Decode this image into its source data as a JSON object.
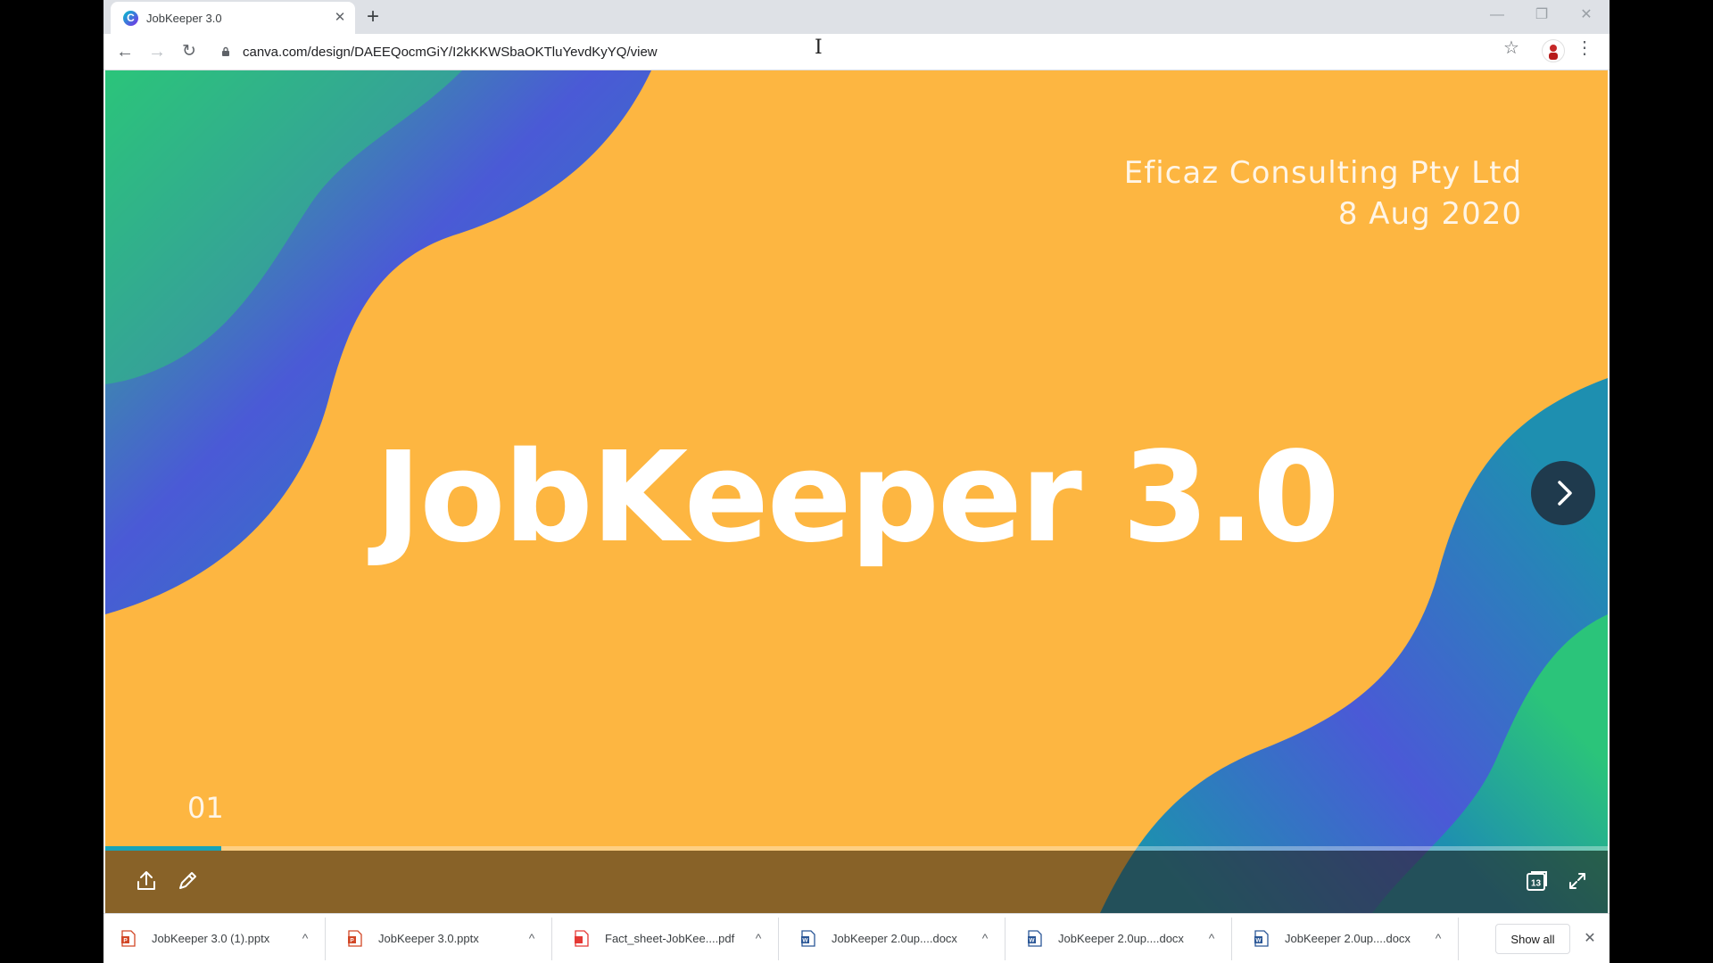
{
  "browser": {
    "tab_title": "JobKeeper 3.0",
    "favicon_letter": "C",
    "url": "canva.com/design/DAEEQocmGiY/I2kKKWSbaOKTluYevdKyYQ/view"
  },
  "slide": {
    "company": "Eficaz Consulting Pty Ltd",
    "date": "8 Aug 2020",
    "title": "JobKeeper 3.0",
    "number": "01",
    "progress": 0.077,
    "colors": {
      "background": "#fdb641",
      "wave_teal": "#1e8fb0",
      "wave_blue": "#4a5ad6",
      "wave_green": "#2bc47a"
    }
  },
  "viewer_controls": {
    "page_count_badge": "13"
  },
  "downloads": {
    "items": [
      {
        "name": "JobKeeper 3.0 (1).pptx",
        "type": "pptx"
      },
      {
        "name": "JobKeeper 3.0.pptx",
        "type": "pptx"
      },
      {
        "name": "Fact_sheet-JobKee....pdf",
        "type": "pdf"
      },
      {
        "name": "JobKeeper 2.0up....docx",
        "type": "docx"
      },
      {
        "name": "JobKeeper 2.0up....docx",
        "type": "docx"
      },
      {
        "name": "JobKeeper 2.0up....docx",
        "type": "docx"
      }
    ],
    "show_all_label": "Show all"
  }
}
